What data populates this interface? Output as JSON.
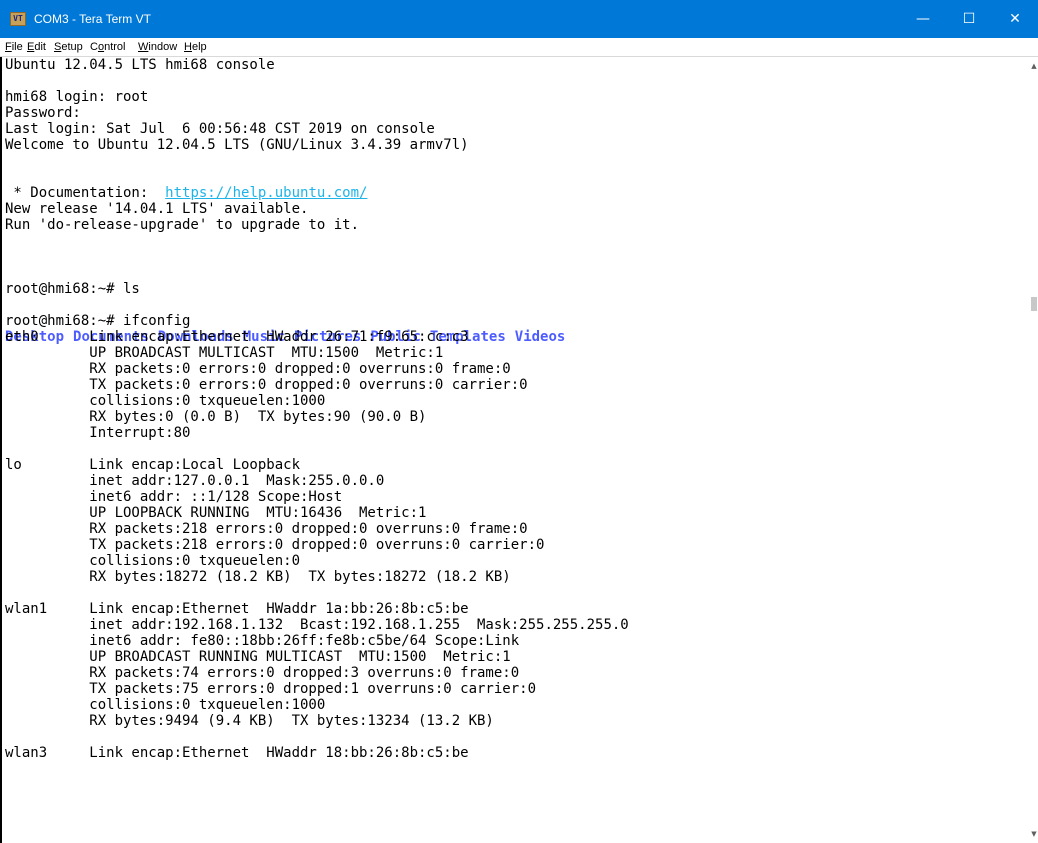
{
  "window": {
    "title": "COM3 - Tera Term VT",
    "icon_label": "VT",
    "controls": {
      "minimize": "—",
      "maximize": "☐",
      "close": "✕"
    }
  },
  "menubar": {
    "items": [
      {
        "key": "F",
        "rest": "ile"
      },
      {
        "key": "E",
        "rest": "dit"
      },
      {
        "key": "S",
        "rest": "etup"
      },
      {
        "key": "",
        "pre": "C",
        "key2": "o",
        "rest": "ntrol"
      },
      {
        "key": "W",
        "rest": "indow"
      },
      {
        "key": "H",
        "rest": "elp"
      }
    ]
  },
  "terminal": {
    "lines": [
      "Ubuntu 12.04.5 LTS hmi68 console",
      "",
      "hmi68 login: root",
      "Password:",
      "Last login: Sat Jul  6 00:56:48 CST 2019 on console",
      "Welcome to Ubuntu 12.04.5 LTS (GNU/Linux 3.4.39 armv7l)",
      "",
      "",
      "",
      "New release '14.04.1 LTS' available.",
      "Run 'do-release-upgrade' to upgrade to it.",
      "",
      "",
      "",
      "root@hmi68:~# ls",
      "",
      "root@hmi68:~# ifconfig",
      "eth0      Link encap:Ethernet  HWaddr 26:71:f9:65:cc:c3",
      "          UP BROADCAST MULTICAST  MTU:1500  Metric:1",
      "          RX packets:0 errors:0 dropped:0 overruns:0 frame:0",
      "          TX packets:0 errors:0 dropped:0 overruns:0 carrier:0",
      "          collisions:0 txqueuelen:1000",
      "          RX bytes:0 (0.0 B)  TX bytes:90 (90.0 B)",
      "          Interrupt:80",
      "",
      "lo        Link encap:Local Loopback",
      "          inet addr:127.0.0.1  Mask:255.0.0.0",
      "          inet6 addr: ::1/128 Scope:Host",
      "          UP LOOPBACK RUNNING  MTU:16436  Metric:1",
      "          RX packets:218 errors:0 dropped:0 overruns:0 frame:0",
      "          TX packets:218 errors:0 dropped:0 overruns:0 carrier:0",
      "          collisions:0 txqueuelen:0",
      "          RX bytes:18272 (18.2 KB)  TX bytes:18272 (18.2 KB)",
      "",
      "wlan1     Link encap:Ethernet  HWaddr 1a:bb:26:8b:c5:be",
      "          inet addr:192.168.1.132  Bcast:192.168.1.255  Mask:255.255.255.0",
      "          inet6 addr: fe80::18bb:26ff:fe8b:c5be/64 Scope:Link",
      "          UP BROADCAST RUNNING MULTICAST  MTU:1500  Metric:1",
      "          RX packets:74 errors:0 dropped:3 overruns:0 frame:0",
      "          TX packets:75 errors:0 dropped:1 overruns:0 carrier:0",
      "          collisions:0 txqueuelen:1000",
      "          RX bytes:9494 (9.4 KB)  TX bytes:13234 (13.2 KB)",
      "",
      "wlan3     Link encap:Ethernet  HWaddr 18:bb:26:8b:c5:be"
    ],
    "documentation_prefix": " * Documentation:  ",
    "documentation_url": "https://help.ubuntu.com/",
    "ls_output": [
      "Desktop",
      "Documents",
      "Downloads",
      "Music",
      "Pictures",
      "Public",
      "Templates",
      "Videos"
    ],
    "colors": {
      "link": "#1fb4e8",
      "directory": "#4c5cff",
      "text": "#000000",
      "background": "#ffffff"
    }
  }
}
